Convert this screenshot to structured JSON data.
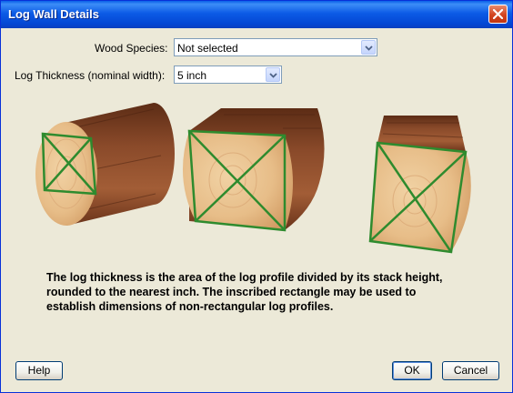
{
  "window": {
    "title": "Log Wall Details"
  },
  "form": {
    "wood_species": {
      "label": "Wood Species:",
      "value": "Not selected"
    },
    "log_thickness": {
      "label": "Log Thickness (nominal width):",
      "value": "5 inch"
    }
  },
  "description": [
    "The log thickness is the area of the log profile divided by its stack height,",
    "rounded to the nearest inch.  The inscribed rectangle may be used to",
    "establish dimensions of non-rectangular log profiles."
  ],
  "buttons": {
    "help": "Help",
    "ok": "OK",
    "cancel": "Cancel"
  },
  "icons": {
    "close": "close-icon",
    "dropdown": "chevron-down-icon"
  },
  "colors": {
    "titlebar": "#0A5FE8",
    "dialog_bg": "#ECE9D8",
    "bark": "#7A3F22",
    "wood_face": "#E8C08E",
    "inscribed_rect": "#2E8B2E"
  }
}
